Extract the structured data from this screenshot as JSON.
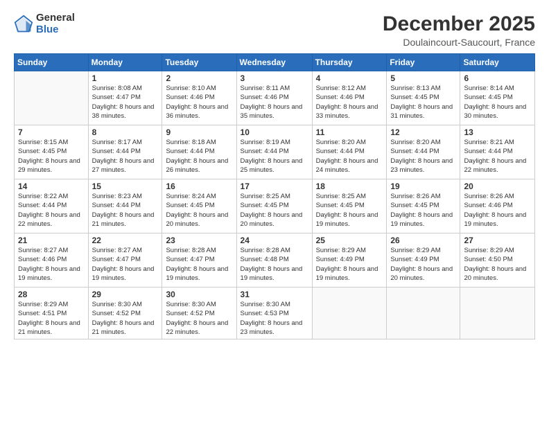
{
  "logo": {
    "general": "General",
    "blue": "Blue"
  },
  "header": {
    "month": "December 2025",
    "location": "Doulaincourt-Saucourt, France"
  },
  "days_of_week": [
    "Sunday",
    "Monday",
    "Tuesday",
    "Wednesday",
    "Thursday",
    "Friday",
    "Saturday"
  ],
  "weeks": [
    [
      {
        "day": "",
        "sunrise": "",
        "sunset": "",
        "daylight": ""
      },
      {
        "day": "1",
        "sunrise": "Sunrise: 8:08 AM",
        "sunset": "Sunset: 4:47 PM",
        "daylight": "Daylight: 8 hours and 38 minutes."
      },
      {
        "day": "2",
        "sunrise": "Sunrise: 8:10 AM",
        "sunset": "Sunset: 4:46 PM",
        "daylight": "Daylight: 8 hours and 36 minutes."
      },
      {
        "day": "3",
        "sunrise": "Sunrise: 8:11 AM",
        "sunset": "Sunset: 4:46 PM",
        "daylight": "Daylight: 8 hours and 35 minutes."
      },
      {
        "day": "4",
        "sunrise": "Sunrise: 8:12 AM",
        "sunset": "Sunset: 4:46 PM",
        "daylight": "Daylight: 8 hours and 33 minutes."
      },
      {
        "day": "5",
        "sunrise": "Sunrise: 8:13 AM",
        "sunset": "Sunset: 4:45 PM",
        "daylight": "Daylight: 8 hours and 31 minutes."
      },
      {
        "day": "6",
        "sunrise": "Sunrise: 8:14 AM",
        "sunset": "Sunset: 4:45 PM",
        "daylight": "Daylight: 8 hours and 30 minutes."
      }
    ],
    [
      {
        "day": "7",
        "sunrise": "Sunrise: 8:15 AM",
        "sunset": "Sunset: 4:45 PM",
        "daylight": "Daylight: 8 hours and 29 minutes."
      },
      {
        "day": "8",
        "sunrise": "Sunrise: 8:17 AM",
        "sunset": "Sunset: 4:44 PM",
        "daylight": "Daylight: 8 hours and 27 minutes."
      },
      {
        "day": "9",
        "sunrise": "Sunrise: 8:18 AM",
        "sunset": "Sunset: 4:44 PM",
        "daylight": "Daylight: 8 hours and 26 minutes."
      },
      {
        "day": "10",
        "sunrise": "Sunrise: 8:19 AM",
        "sunset": "Sunset: 4:44 PM",
        "daylight": "Daylight: 8 hours and 25 minutes."
      },
      {
        "day": "11",
        "sunrise": "Sunrise: 8:20 AM",
        "sunset": "Sunset: 4:44 PM",
        "daylight": "Daylight: 8 hours and 24 minutes."
      },
      {
        "day": "12",
        "sunrise": "Sunrise: 8:20 AM",
        "sunset": "Sunset: 4:44 PM",
        "daylight": "Daylight: 8 hours and 23 minutes."
      },
      {
        "day": "13",
        "sunrise": "Sunrise: 8:21 AM",
        "sunset": "Sunset: 4:44 PM",
        "daylight": "Daylight: 8 hours and 22 minutes."
      }
    ],
    [
      {
        "day": "14",
        "sunrise": "Sunrise: 8:22 AM",
        "sunset": "Sunset: 4:44 PM",
        "daylight": "Daylight: 8 hours and 22 minutes."
      },
      {
        "day": "15",
        "sunrise": "Sunrise: 8:23 AM",
        "sunset": "Sunset: 4:44 PM",
        "daylight": "Daylight: 8 hours and 21 minutes."
      },
      {
        "day": "16",
        "sunrise": "Sunrise: 8:24 AM",
        "sunset": "Sunset: 4:45 PM",
        "daylight": "Daylight: 8 hours and 20 minutes."
      },
      {
        "day": "17",
        "sunrise": "Sunrise: 8:25 AM",
        "sunset": "Sunset: 4:45 PM",
        "daylight": "Daylight: 8 hours and 20 minutes."
      },
      {
        "day": "18",
        "sunrise": "Sunrise: 8:25 AM",
        "sunset": "Sunset: 4:45 PM",
        "daylight": "Daylight: 8 hours and 19 minutes."
      },
      {
        "day": "19",
        "sunrise": "Sunrise: 8:26 AM",
        "sunset": "Sunset: 4:45 PM",
        "daylight": "Daylight: 8 hours and 19 minutes."
      },
      {
        "day": "20",
        "sunrise": "Sunrise: 8:26 AM",
        "sunset": "Sunset: 4:46 PM",
        "daylight": "Daylight: 8 hours and 19 minutes."
      }
    ],
    [
      {
        "day": "21",
        "sunrise": "Sunrise: 8:27 AM",
        "sunset": "Sunset: 4:46 PM",
        "daylight": "Daylight: 8 hours and 19 minutes."
      },
      {
        "day": "22",
        "sunrise": "Sunrise: 8:27 AM",
        "sunset": "Sunset: 4:47 PM",
        "daylight": "Daylight: 8 hours and 19 minutes."
      },
      {
        "day": "23",
        "sunrise": "Sunrise: 8:28 AM",
        "sunset": "Sunset: 4:47 PM",
        "daylight": "Daylight: 8 hours and 19 minutes."
      },
      {
        "day": "24",
        "sunrise": "Sunrise: 8:28 AM",
        "sunset": "Sunset: 4:48 PM",
        "daylight": "Daylight: 8 hours and 19 minutes."
      },
      {
        "day": "25",
        "sunrise": "Sunrise: 8:29 AM",
        "sunset": "Sunset: 4:49 PM",
        "daylight": "Daylight: 8 hours and 19 minutes."
      },
      {
        "day": "26",
        "sunrise": "Sunrise: 8:29 AM",
        "sunset": "Sunset: 4:49 PM",
        "daylight": "Daylight: 8 hours and 20 minutes."
      },
      {
        "day": "27",
        "sunrise": "Sunrise: 8:29 AM",
        "sunset": "Sunset: 4:50 PM",
        "daylight": "Daylight: 8 hours and 20 minutes."
      }
    ],
    [
      {
        "day": "28",
        "sunrise": "Sunrise: 8:29 AM",
        "sunset": "Sunset: 4:51 PM",
        "daylight": "Daylight: 8 hours and 21 minutes."
      },
      {
        "day": "29",
        "sunrise": "Sunrise: 8:30 AM",
        "sunset": "Sunset: 4:52 PM",
        "daylight": "Daylight: 8 hours and 21 minutes."
      },
      {
        "day": "30",
        "sunrise": "Sunrise: 8:30 AM",
        "sunset": "Sunset: 4:52 PM",
        "daylight": "Daylight: 8 hours and 22 minutes."
      },
      {
        "day": "31",
        "sunrise": "Sunrise: 8:30 AM",
        "sunset": "Sunset: 4:53 PM",
        "daylight": "Daylight: 8 hours and 23 minutes."
      },
      {
        "day": "",
        "sunrise": "",
        "sunset": "",
        "daylight": ""
      },
      {
        "day": "",
        "sunrise": "",
        "sunset": "",
        "daylight": ""
      },
      {
        "day": "",
        "sunrise": "",
        "sunset": "",
        "daylight": ""
      }
    ]
  ]
}
